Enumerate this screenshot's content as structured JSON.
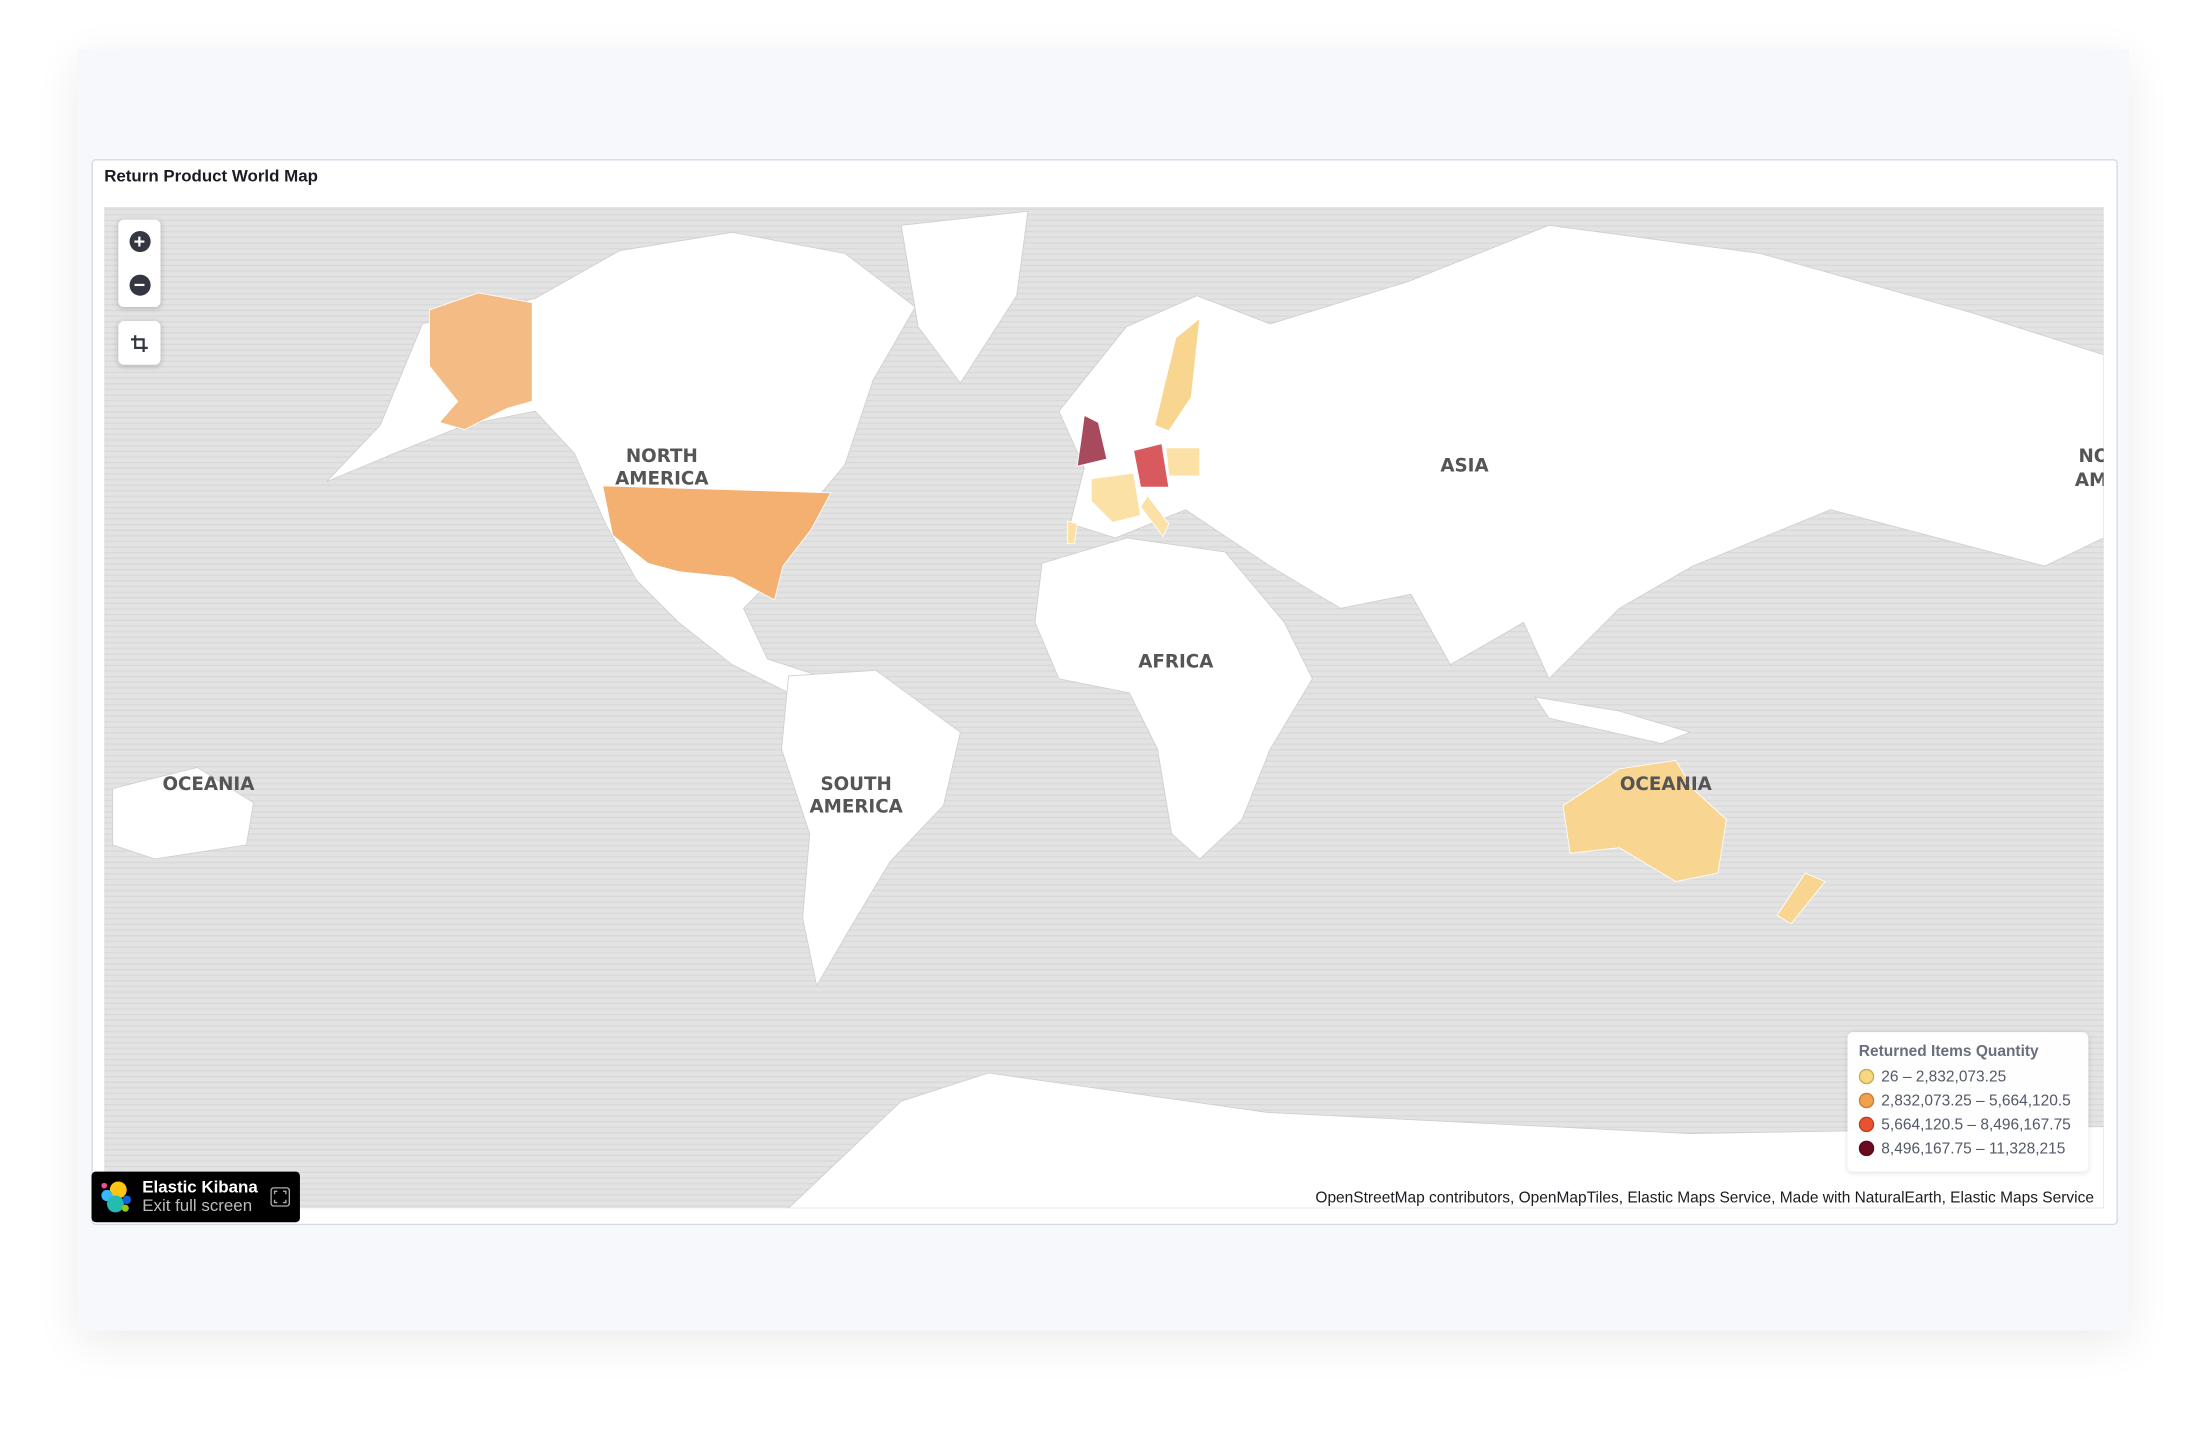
{
  "panel": {
    "title": "Return Product World Map"
  },
  "controls": {
    "zoom_in": "zoom-in",
    "zoom_out": "zoom-out",
    "fit": "fit-to-data"
  },
  "map_labels": [
    "NORTH",
    "AMERICA",
    "ASIA",
    "AFRICA",
    "SOUTH",
    "AMERICA",
    "OCEANIA",
    "OCEANIA",
    "NO",
    "AM"
  ],
  "legend": {
    "title": "Returned Items Quantity",
    "items": [
      {
        "label": "26 – 2,832,073.25",
        "color": "#f8d77e"
      },
      {
        "label": "2,832,073.25 – 5,664,120.5",
        "color": "#f3a04c"
      },
      {
        "label": "5,664,120.5 – 8,496,167.75",
        "color": "#e8522f"
      },
      {
        "label": "8,496,167.75 – 11,328,215",
        "color": "#6b0b1f"
      }
    ]
  },
  "regions": [
    {
      "name": "United States",
      "fill": "#f3b070"
    },
    {
      "name": "Alaska",
      "fill": "#f5bb85"
    },
    {
      "name": "United Kingdom",
      "fill": "#a84a5e"
    },
    {
      "name": "Germany",
      "fill": "#d85a5f"
    },
    {
      "name": "France",
      "fill": "#fbe1a6"
    },
    {
      "name": "Sweden",
      "fill": "#f8d690"
    },
    {
      "name": "Poland",
      "fill": "#fbe1a6"
    },
    {
      "name": "Italy",
      "fill": "#fbe1a6"
    },
    {
      "name": "Portugal",
      "fill": "#fbe1a6"
    },
    {
      "name": "Australia",
      "fill": "#f8d590"
    },
    {
      "name": "New Zealand",
      "fill": "#f8d590"
    }
  ],
  "attribution": "OpenStreetMap contributors, OpenMapTiles, Elastic Maps Service, Made with NaturalEarth, Elastic Maps Service",
  "badge": {
    "title": "Elastic Kibana",
    "subtitle": "Exit full screen"
  }
}
